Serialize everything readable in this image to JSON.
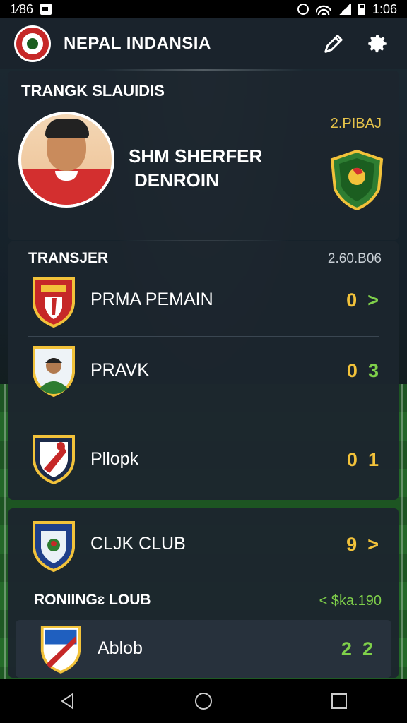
{
  "status_bar": {
    "left_text": "1⁄86",
    "time": "1:06"
  },
  "app_bar": {
    "title": "NEPAL  INDANSIA",
    "logo": "club-logo",
    "edit_icon": "pen-icon",
    "settings_icon": "gear-icon"
  },
  "profile": {
    "header": "TRANGK SLAUIDIS",
    "player_name_line1": "SHM SHERFER",
    "player_name_line2": "DENROIN",
    "badge_label": "2.PIBAJ"
  },
  "transfers": {
    "title": "TRANSJER",
    "value": "2.60.B06",
    "rows": [
      {
        "name": "PRMA PEMAIN",
        "score": "0",
        "suffix": ">"
      },
      {
        "name": "PRAVK",
        "score": "0",
        "suffix": "3"
      },
      {
        "name": "Pllopk",
        "score": "0",
        "suffix": "1"
      }
    ]
  },
  "clubs": {
    "club_row": {
      "name": "CLJK CLUB",
      "score": "9",
      "suffix": ">"
    },
    "ranking_title": "RONIINGɛ LOUB",
    "ranking_value": "< $ka.190",
    "rank_row": {
      "name": "Ablob",
      "score": "2",
      "suffix": "2"
    }
  },
  "colors": {
    "accent_yellow": "#f2c23a",
    "accent_green": "#7fd04a",
    "card_bg": "#1c252e"
  }
}
